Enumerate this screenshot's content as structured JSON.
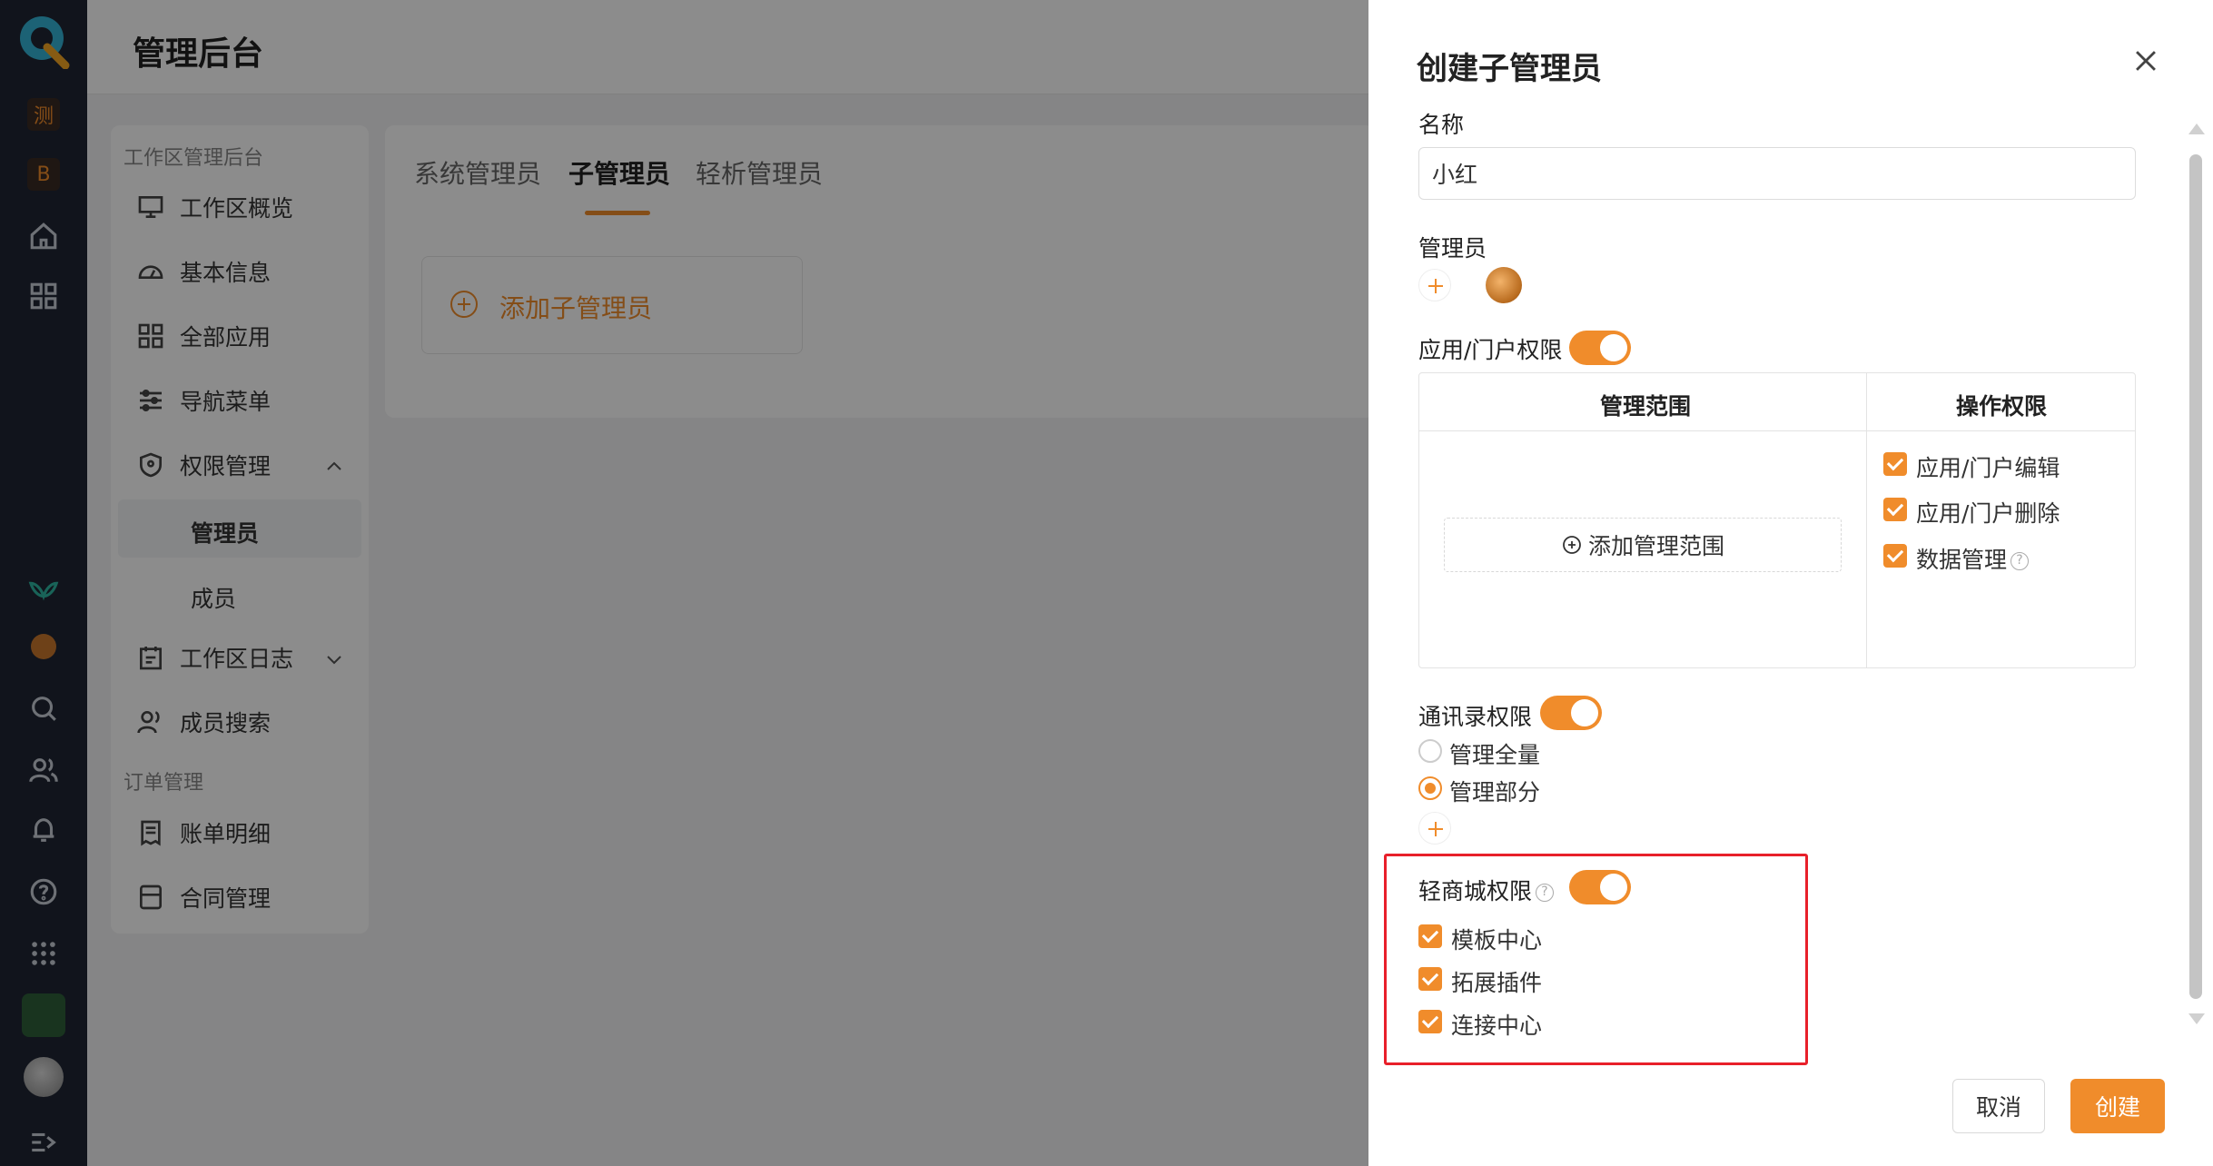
{
  "rail": {
    "badges": [
      "测",
      "B"
    ]
  },
  "app": {
    "title": "管理后台",
    "nav": {
      "group1": "工作区管理后台",
      "items": [
        "工作区概览",
        "基本信息",
        "全部应用",
        "导航菜单",
        "权限管理"
      ],
      "sub_items": [
        "管理员",
        "成员"
      ],
      "items2": [
        "工作区日志",
        "成员搜索"
      ],
      "group2": "订单管理",
      "items3": [
        "账单明细",
        "合同管理"
      ]
    },
    "tabs": [
      "系统管理员",
      "子管理员",
      "轻析管理员"
    ],
    "active_tab": "子管理员",
    "add_sub_admin": "添加子管理员"
  },
  "drawer": {
    "title": "创建子管理员",
    "name_label": "名称",
    "name_value": "小红",
    "admin_label": "管理员",
    "app_perm_label": "应用/门户权限",
    "app_perm_on": true,
    "table": {
      "col_scope": "管理范围",
      "col_ops": "操作权限",
      "add_scope": "添加管理范围",
      "ops": [
        "应用/门户编辑",
        "应用/门户删除",
        "数据管理"
      ]
    },
    "contacts_label": "通讯录权限",
    "contacts_on": true,
    "contacts_options": [
      "管理全量",
      "管理部分"
    ],
    "contacts_selected": "管理部分",
    "mall_label": "轻商城权限",
    "mall_on": true,
    "mall_items": [
      "模板中心",
      "拓展插件",
      "连接中心"
    ],
    "cancel": "取消",
    "create": "创建"
  },
  "colors": {
    "accent": "#f08c2b",
    "highlight": "#e8202a",
    "rail": "#1f2633"
  }
}
